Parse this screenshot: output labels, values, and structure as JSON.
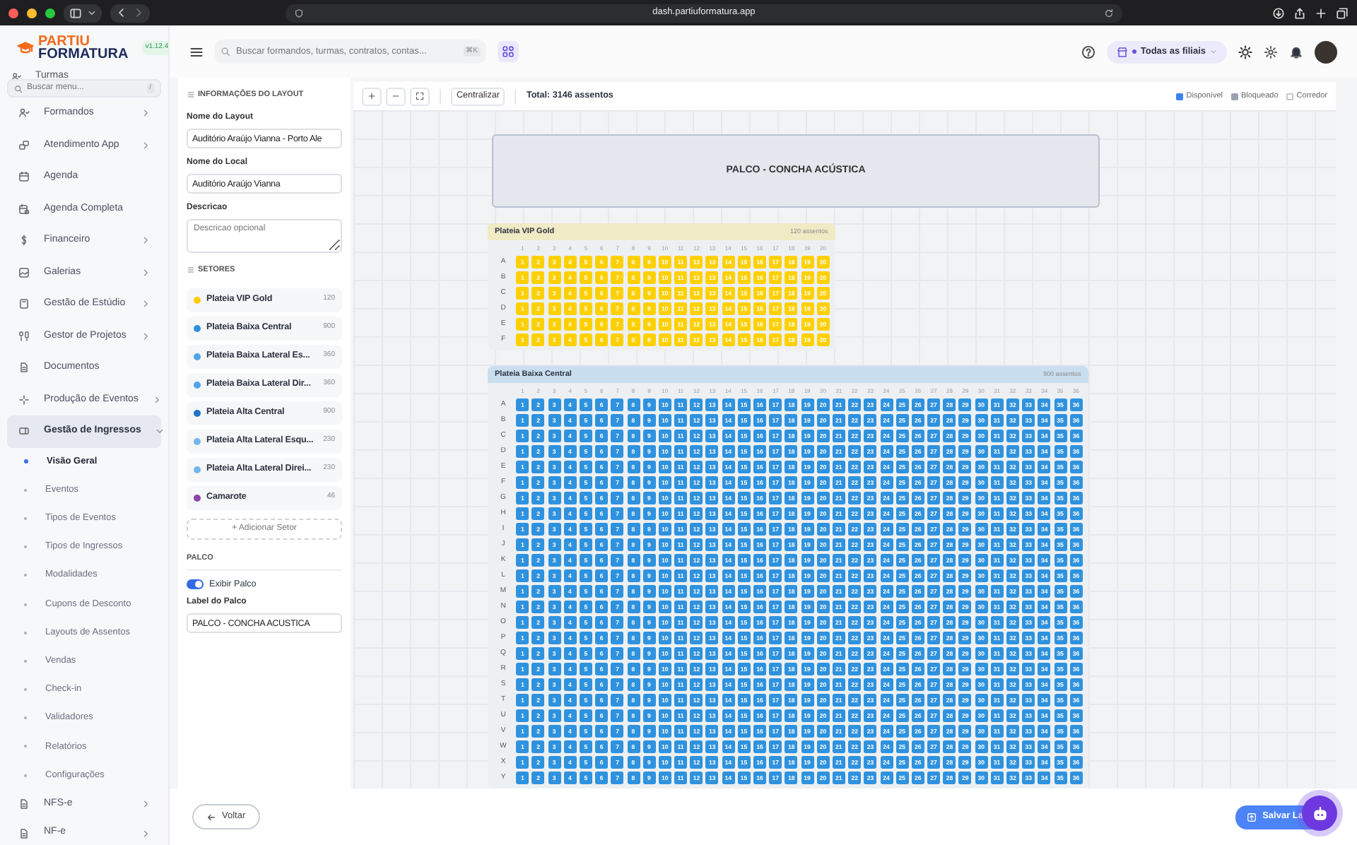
{
  "browser": {
    "url": "dash.partiuformatura.app"
  },
  "sidebar": {
    "logo": {
      "line_1": "PARTIU",
      "line_2": "FORMATURA",
      "version": "v1.12.4"
    },
    "partial_item": {
      "label": "Turmas"
    },
    "search": {
      "placeholder": "Buscar menu...",
      "shortcut": "/"
    },
    "items": [
      {
        "label": "Formandos",
        "expandable": true,
        "expanded": false,
        "selected": false
      },
      {
        "label": "Atendimento App",
        "expandable": true,
        "expanded": false,
        "selected": false
      },
      {
        "label": "Agenda",
        "expandable": false,
        "selected": false
      },
      {
        "label": "Agenda Completa",
        "expandable": false,
        "selected": false
      },
      {
        "label": "Financeiro",
        "expandable": true,
        "expanded": false,
        "selected": false
      },
      {
        "label": "Galerias",
        "expandable": true,
        "expanded": false,
        "selected": false
      },
      {
        "label": "Gestão de Estúdio",
        "expandable": true,
        "expanded": false,
        "selected": false
      },
      {
        "label": "Gestor de Projetos",
        "expandable": true,
        "expanded": false,
        "selected": false
      },
      {
        "label": "Documentos",
        "expandable": false,
        "selected": false
      },
      {
        "label": "Produção de Eventos",
        "expandable": true,
        "expanded": false,
        "selected": false
      },
      {
        "label": "Gestão de Ingressos",
        "expandable": true,
        "expanded": true,
        "selected": true,
        "children": [
          {
            "label": "Visão Geral",
            "selected": true
          },
          {
            "label": "Eventos",
            "selected": false
          },
          {
            "label": "Tipos de Eventos",
            "selected": false
          },
          {
            "label": "Tipos de Ingressos",
            "selected": false
          },
          {
            "label": "Modalidades",
            "selected": false
          },
          {
            "label": "Cupons de Desconto",
            "selected": false
          },
          {
            "label": "Layouts de Assentos",
            "selected": false
          },
          {
            "label": "Vendas",
            "selected": false
          },
          {
            "label": "Check-in",
            "selected": false
          },
          {
            "label": "Validadores",
            "selected": false
          },
          {
            "label": "Relatórios",
            "selected": false
          },
          {
            "label": "Configurações",
            "selected": false
          }
        ]
      },
      {
        "label": "NFS-e",
        "expandable": true,
        "expanded": false,
        "selected": false
      },
      {
        "label": "NF-e",
        "expandable": true,
        "expanded": false,
        "selected": false
      }
    ]
  },
  "header": {
    "search": {
      "placeholder": "Buscar formandos, turmas, contratos, contas...",
      "shortcut": "⌘K"
    },
    "branch": "Todas as filiais"
  },
  "layout_panel": {
    "info_title": "INFORMAÇÕES DO LAYOUT",
    "fields": [
      {
        "label": "Nome do Layout",
        "value": "Auditório Araújo Vianna - Porto Ale"
      },
      {
        "label": "Nome do Local",
        "value": "Auditório Araújo Vianna"
      }
    ],
    "description": {
      "label": "Descricao",
      "placeholder": "Descricao opcional"
    },
    "sectors_title": "SETORES",
    "sectors": [
      {
        "name": "Plateia VIP Gold",
        "count": "120",
        "color": "#ffcc00"
      },
      {
        "name": "Plateia Baixa Central",
        "count": "900",
        "color": "#2e8fe0"
      },
      {
        "name": "Plateia Baixa Lateral Es...",
        "count": "360",
        "color": "#4fa3ea"
      },
      {
        "name": "Plateia Baixa Lateral Dir...",
        "count": "360",
        "color": "#4fa3ea"
      },
      {
        "name": "Plateia Alta Central",
        "count": "900",
        "color": "#1f74c4"
      },
      {
        "name": "Plateia Alta Lateral Esqu...",
        "count": "230",
        "color": "#74b6ee"
      },
      {
        "name": "Plateia Alta Lateral Direi...",
        "count": "230",
        "color": "#74b6ee"
      },
      {
        "name": "Camarote",
        "count": "46",
        "color": "#8e44ad"
      }
    ],
    "add_sector": "+ Adicionar Setor",
    "stage_title": "PALCO",
    "stage_toggle": {
      "label": "Exibir Palco",
      "on": true
    },
    "stage_label": {
      "label": "Label do Palco",
      "value": "PALCO - CONCHA ACÚSTICA"
    }
  },
  "toolbar": {
    "center_button": "Centralizar",
    "total": "Total: 3146 assentos",
    "legend": [
      {
        "label": "Disponível",
        "kind": "fill",
        "color": "#3b82f6"
      },
      {
        "label": "Bloqueado",
        "kind": "fill",
        "color": "#9ca3af"
      },
      {
        "label": "Corredor",
        "kind": "outline",
        "color": "#c4c8ce"
      }
    ]
  },
  "canvas": {
    "stage": "PALCO - CONCHA ACÚSTICA",
    "sections": [
      {
        "name": "Plateia VIP Gold",
        "count": "120 assentos",
        "color": "#ffd000",
        "column_numbers": [
          "1",
          "2",
          "3",
          "4",
          "5",
          "6",
          "7",
          "8",
          "9",
          "10",
          "11",
          "12",
          "13",
          "14",
          "15",
          "16",
          "17",
          "18",
          "19",
          "20"
        ],
        "rows": [
          {
            "label": "A",
            "seats": [
              "1",
              "2",
              "3",
              "4",
              "5",
              "6",
              "7",
              "8",
              "9",
              "10",
              "11",
              "12",
              "13",
              "14",
              "15",
              "16",
              "17",
              "18",
              "19",
              "20"
            ]
          },
          {
            "label": "B",
            "seats": [
              "1",
              "2",
              "3",
              "4",
              "5",
              "6",
              "7",
              "8",
              "9",
              "10",
              "11",
              "12",
              "13",
              "14",
              "15",
              "16",
              "17",
              "18",
              "19",
              "20"
            ]
          },
          {
            "label": "C",
            "seats": [
              "1",
              "2",
              "3",
              "4",
              "5",
              "6",
              "7",
              "8",
              "9",
              "10",
              "11",
              "12",
              "13",
              "14",
              "15",
              "16",
              "17",
              "18",
              "19",
              "20"
            ]
          },
          {
            "label": "D",
            "seats": [
              "1",
              "2",
              "3",
              "4",
              "5",
              "6",
              "7",
              "8",
              "9",
              "10",
              "11",
              "12",
              "13",
              "14",
              "15",
              "16",
              "17",
              "18",
              "19",
              "20"
            ]
          },
          {
            "label": "E",
            "seats": [
              "1",
              "2",
              "3",
              "4",
              "5",
              "6",
              "7",
              "8",
              "9",
              "10",
              "11",
              "12",
              "13",
              "14",
              "15",
              "16",
              "17",
              "18",
              "19",
              "20"
            ]
          },
          {
            "label": "F",
            "seats": [
              "1",
              "2",
              "3",
              "4",
              "5",
              "6",
              "7",
              "8",
              "9",
              "10",
              "11",
              "12",
              "13",
              "14",
              "15",
              "16",
              "17",
              "18",
              "19",
              "20"
            ]
          }
        ]
      },
      {
        "name": "Plateia Baixa Central",
        "count": "900 assentos",
        "color": "#2f92de",
        "column_numbers": [
          "1",
          "2",
          "3",
          "4",
          "5",
          "6",
          "7",
          "8",
          "9",
          "10",
          "11",
          "12",
          "13",
          "14",
          "15",
          "16",
          "17",
          "18",
          "19",
          "20",
          "21",
          "22",
          "23",
          "24",
          "25",
          "26",
          "27",
          "28",
          "29",
          "30",
          "31",
          "32",
          "33",
          "34",
          "35",
          "36"
        ],
        "rows": [
          {
            "label": "A",
            "seats": [
              "1",
              "2",
              "3",
              "4",
              "5",
              "6",
              "7",
              "8",
              "9",
              "10",
              "11",
              "12",
              "13",
              "14",
              "15",
              "16",
              "17",
              "18",
              "19",
              "20",
              "21",
              "22",
              "23",
              "24",
              "25",
              "26",
              "27",
              "28",
              "29",
              "30",
              "31",
              "32",
              "33",
              "34",
              "35",
              "36"
            ]
          },
          {
            "label": "B",
            "seats": [
              "1",
              "2",
              "3",
              "4",
              "5",
              "6",
              "7",
              "8",
              "9",
              "10",
              "11",
              "12",
              "13",
              "14",
              "15",
              "16",
              "17",
              "18",
              "19",
              "20",
              "21",
              "22",
              "23",
              "24",
              "25",
              "26",
              "27",
              "28",
              "29",
              "30",
              "31",
              "32",
              "33",
              "34",
              "35",
              "36"
            ]
          },
          {
            "label": "C",
            "seats": [
              "1",
              "2",
              "3",
              "4",
              "5",
              "6",
              "7",
              "8",
              "9",
              "10",
              "11",
              "12",
              "13",
              "14",
              "15",
              "16",
              "17",
              "18",
              "19",
              "20",
              "21",
              "22",
              "23",
              "24",
              "25",
              "26",
              "27",
              "28",
              "29",
              "30",
              "31",
              "32",
              "33",
              "34",
              "35",
              "36"
            ]
          },
          {
            "label": "D",
            "seats": [
              "1",
              "2",
              "3",
              "4",
              "5",
              "6",
              "7",
              "8",
              "9",
              "10",
              "11",
              "12",
              "13",
              "14",
              "15",
              "16",
              "17",
              "18",
              "19",
              "20",
              "21",
              "22",
              "23",
              "24",
              "25",
              "26",
              "27",
              "28",
              "29",
              "30",
              "31",
              "32",
              "33",
              "34",
              "35",
              "36"
            ]
          },
          {
            "label": "E",
            "seats": [
              "1",
              "2",
              "3",
              "4",
              "5",
              "6",
              "7",
              "8",
              "9",
              "10",
              "11",
              "12",
              "13",
              "14",
              "15",
              "16",
              "17",
              "18",
              "19",
              "20",
              "21",
              "22",
              "23",
              "24",
              "25",
              "26",
              "27",
              "28",
              "29",
              "30",
              "31",
              "32",
              "33",
              "34",
              "35",
              "36"
            ]
          },
          {
            "label": "F",
            "seats": [
              "1",
              "2",
              "3",
              "4",
              "5",
              "6",
              "7",
              "8",
              "9",
              "10",
              "11",
              "12",
              "13",
              "14",
              "15",
              "16",
              "17",
              "18",
              "19",
              "20",
              "21",
              "22",
              "23",
              "24",
              "25",
              "26",
              "27",
              "28",
              "29",
              "30",
              "31",
              "32",
              "33",
              "34",
              "35",
              "36"
            ]
          },
          {
            "label": "G",
            "seats": [
              "1",
              "2",
              "3",
              "4",
              "5",
              "6",
              "7",
              "8",
              "9",
              "10",
              "11",
              "12",
              "13",
              "14",
              "15",
              "16",
              "17",
              "18",
              "19",
              "20",
              "21",
              "22",
              "23",
              "24",
              "25",
              "26",
              "27",
              "28",
              "29",
              "30",
              "31",
              "32",
              "33",
              "34",
              "35",
              "36"
            ]
          },
          {
            "label": "H",
            "seats": [
              "1",
              "2",
              "3",
              "4",
              "5",
              "6",
              "7",
              "8",
              "9",
              "10",
              "11",
              "12",
              "13",
              "14",
              "15",
              "16",
              "17",
              "18",
              "19",
              "20",
              "21",
              "22",
              "23",
              "24",
              "25",
              "26",
              "27",
              "28",
              "29",
              "30",
              "31",
              "32",
              "33",
              "34",
              "35",
              "36"
            ]
          },
          {
            "label": "I",
            "seats": [
              "1",
              "2",
              "3",
              "4",
              "5",
              "6",
              "7",
              "8",
              "9",
              "10",
              "11",
              "12",
              "13",
              "14",
              "15",
              "16",
              "17",
              "18",
              "19",
              "20",
              "21",
              "22",
              "23",
              "24",
              "25",
              "26",
              "27",
              "28",
              "29",
              "30",
              "31",
              "32",
              "33",
              "34",
              "35",
              "36"
            ]
          },
          {
            "label": "J",
            "seats": [
              "1",
              "2",
              "3",
              "4",
              "5",
              "6",
              "7",
              "8",
              "9",
              "10",
              "11",
              "12",
              "13",
              "14",
              "15",
              "16",
              "17",
              "18",
              "19",
              "20",
              "21",
              "22",
              "23",
              "24",
              "25",
              "26",
              "27",
              "28",
              "29",
              "30",
              "31",
              "32",
              "33",
              "34",
              "35",
              "36"
            ]
          },
          {
            "label": "K",
            "seats": [
              "1",
              "2",
              "3",
              "4",
              "5",
              "6",
              "7",
              "8",
              "9",
              "10",
              "11",
              "12",
              "13",
              "14",
              "15",
              "16",
              "17",
              "18",
              "19",
              "20",
              "21",
              "22",
              "23",
              "24",
              "25",
              "26",
              "27",
              "28",
              "29",
              "30",
              "31",
              "32",
              "33",
              "34",
              "35",
              "36"
            ]
          },
          {
            "label": "L",
            "seats": [
              "1",
              "2",
              "3",
              "4",
              "5",
              "6",
              "7",
              "8",
              "9",
              "10",
              "11",
              "12",
              "13",
              "14",
              "15",
              "16",
              "17",
              "18",
              "19",
              "20",
              "21",
              "22",
              "23",
              "24",
              "25",
              "26",
              "27",
              "28",
              "29",
              "30",
              "31",
              "32",
              "33",
              "34",
              "35",
              "36"
            ]
          },
          {
            "label": "M",
            "seats": [
              "1",
              "2",
              "3",
              "4",
              "5",
              "6",
              "7",
              "8",
              "9",
              "10",
              "11",
              "12",
              "13",
              "14",
              "15",
              "16",
              "17",
              "18",
              "19",
              "20",
              "21",
              "22",
              "23",
              "24",
              "25",
              "26",
              "27",
              "28",
              "29",
              "30",
              "31",
              "32",
              "33",
              "34",
              "35",
              "36"
            ]
          },
          {
            "label": "N",
            "seats": [
              "1",
              "2",
              "3",
              "4",
              "5",
              "6",
              "7",
              "8",
              "9",
              "10",
              "11",
              "12",
              "13",
              "14",
              "15",
              "16",
              "17",
              "18",
              "19",
              "20",
              "21",
              "22",
              "23",
              "24",
              "25",
              "26",
              "27",
              "28",
              "29",
              "30",
              "31",
              "32",
              "33",
              "34",
              "35",
              "36"
            ]
          },
          {
            "label": "O",
            "seats": [
              "1",
              "2",
              "3",
              "4",
              "5",
              "6",
              "7",
              "8",
              "9",
              "10",
              "11",
              "12",
              "13",
              "14",
              "15",
              "16",
              "17",
              "18",
              "19",
              "20",
              "21",
              "22",
              "23",
              "24",
              "25",
              "26",
              "27",
              "28",
              "29",
              "30",
              "31",
              "32",
              "33",
              "34",
              "35",
              "36"
            ]
          },
          {
            "label": "P",
            "seats": [
              "1",
              "2",
              "3",
              "4",
              "5",
              "6",
              "7",
              "8",
              "9",
              "10",
              "11",
              "12",
              "13",
              "14",
              "15",
              "16",
              "17",
              "18",
              "19",
              "20",
              "21",
              "22",
              "23",
              "24",
              "25",
              "26",
              "27",
              "28",
              "29",
              "30",
              "31",
              "32",
              "33",
              "34",
              "35",
              "36"
            ]
          },
          {
            "label": "Q",
            "seats": [
              "1",
              "2",
              "3",
              "4",
              "5",
              "6",
              "7",
              "8",
              "9",
              "10",
              "11",
              "12",
              "13",
              "14",
              "15",
              "16",
              "17",
              "18",
              "19",
              "20",
              "21",
              "22",
              "23",
              "24",
              "25",
              "26",
              "27",
              "28",
              "29",
              "30",
              "31",
              "32",
              "33",
              "34",
              "35",
              "36"
            ]
          },
          {
            "label": "R",
            "seats": [
              "1",
              "2",
              "3",
              "4",
              "5",
              "6",
              "7",
              "8",
              "9",
              "10",
              "11",
              "12",
              "13",
              "14",
              "15",
              "16",
              "17",
              "18",
              "19",
              "20",
              "21",
              "22",
              "23",
              "24",
              "25",
              "26",
              "27",
              "28",
              "29",
              "30",
              "31",
              "32",
              "33",
              "34",
              "35",
              "36"
            ]
          },
          {
            "label": "S",
            "seats": [
              "1",
              "2",
              "3",
              "4",
              "5",
              "6",
              "7",
              "8",
              "9",
              "10",
              "11",
              "12",
              "13",
              "14",
              "15",
              "16",
              "17",
              "18",
              "19",
              "20",
              "21",
              "22",
              "23",
              "24",
              "25",
              "26",
              "27",
              "28",
              "29",
              "30",
              "31",
              "32",
              "33",
              "34",
              "35",
              "36"
            ]
          },
          {
            "label": "T",
            "seats": [
              "1",
              "2",
              "3",
              "4",
              "5",
              "6",
              "7",
              "8",
              "9",
              "10",
              "11",
              "12",
              "13",
              "14",
              "15",
              "16",
              "17",
              "18",
              "19",
              "20",
              "21",
              "22",
              "23",
              "24",
              "25",
              "26",
              "27",
              "28",
              "29",
              "30",
              "31",
              "32",
              "33",
              "34",
              "35",
              "36"
            ]
          },
          {
            "label": "U",
            "seats": [
              "1",
              "2",
              "3",
              "4",
              "5",
              "6",
              "7",
              "8",
              "9",
              "10",
              "11",
              "12",
              "13",
              "14",
              "15",
              "16",
              "17",
              "18",
              "19",
              "20",
              "21",
              "22",
              "23",
              "24",
              "25",
              "26",
              "27",
              "28",
              "29",
              "30",
              "31",
              "32",
              "33",
              "34",
              "35",
              "36"
            ]
          },
          {
            "label": "V",
            "seats": [
              "1",
              "2",
              "3",
              "4",
              "5",
              "6",
              "7",
              "8",
              "9",
              "10",
              "11",
              "12",
              "13",
              "14",
              "15",
              "16",
              "17",
              "18",
              "19",
              "20",
              "21",
              "22",
              "23",
              "24",
              "25",
              "26",
              "27",
              "28",
              "29",
              "30",
              "31",
              "32",
              "33",
              "34",
              "35",
              "36"
            ]
          },
          {
            "label": "W",
            "seats": [
              "1",
              "2",
              "3",
              "4",
              "5",
              "6",
              "7",
              "8",
              "9",
              "10",
              "11",
              "12",
              "13",
              "14",
              "15",
              "16",
              "17",
              "18",
              "19",
              "20",
              "21",
              "22",
              "23",
              "24",
              "25",
              "26",
              "27",
              "28",
              "29",
              "30",
              "31",
              "32",
              "33",
              "34",
              "35",
              "36"
            ]
          },
          {
            "label": "X",
            "seats": [
              "1",
              "2",
              "3",
              "4",
              "5",
              "6",
              "7",
              "8",
              "9",
              "10",
              "11",
              "12",
              "13",
              "14",
              "15",
              "16",
              "17",
              "18",
              "19",
              "20",
              "21",
              "22",
              "23",
              "24",
              "25",
              "26",
              "27",
              "28",
              "29",
              "30",
              "31",
              "32",
              "33",
              "34",
              "35",
              "36"
            ]
          },
          {
            "label": "Y",
            "seats": [
              "1",
              "2",
              "3",
              "4",
              "5",
              "6",
              "7",
              "8",
              "9",
              "10",
              "11",
              "12",
              "13",
              "14",
              "15",
              "16",
              "17",
              "18",
              "19",
              "20",
              "21",
              "22",
              "23",
              "24",
              "25",
              "26",
              "27",
              "28",
              "29",
              "30",
              "31",
              "32",
              "33",
              "34",
              "35",
              "36"
            ]
          }
        ]
      }
    ]
  },
  "footer": {
    "back_button": "Voltar",
    "save_button": "Salvar La"
  }
}
